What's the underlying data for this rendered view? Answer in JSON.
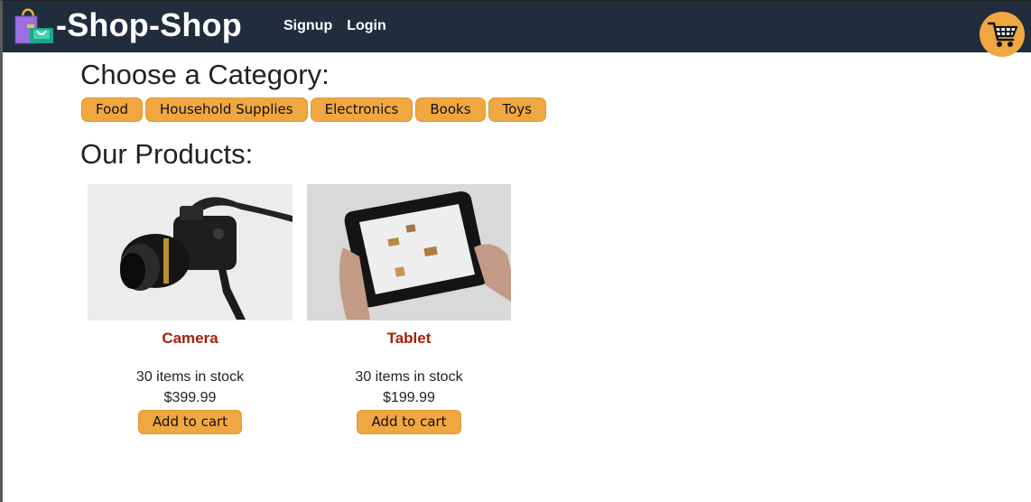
{
  "header": {
    "brand": "-Shop-Shop",
    "logo_icon": "shopping-bags-icon",
    "nav": [
      {
        "label": "Signup"
      },
      {
        "label": "Login"
      }
    ],
    "cart_icon": "shopping-cart-icon"
  },
  "categories": {
    "title": "Choose a Category:",
    "items": [
      {
        "label": "Food"
      },
      {
        "label": "Household Supplies"
      },
      {
        "label": "Electronics"
      },
      {
        "label": "Books"
      },
      {
        "label": "Toys"
      }
    ]
  },
  "products": {
    "title": "Our Products:",
    "items": [
      {
        "name": "Camera",
        "stock": "30 items in stock",
        "price": "$399.99",
        "button": "Add to cart"
      },
      {
        "name": "Tablet",
        "stock": "30 items in stock",
        "price": "$199.99",
        "button": "Add to cart"
      }
    ]
  },
  "colors": {
    "header_bg": "#212d3d",
    "accent": "#f0a741",
    "product_name": "#a5200b"
  }
}
